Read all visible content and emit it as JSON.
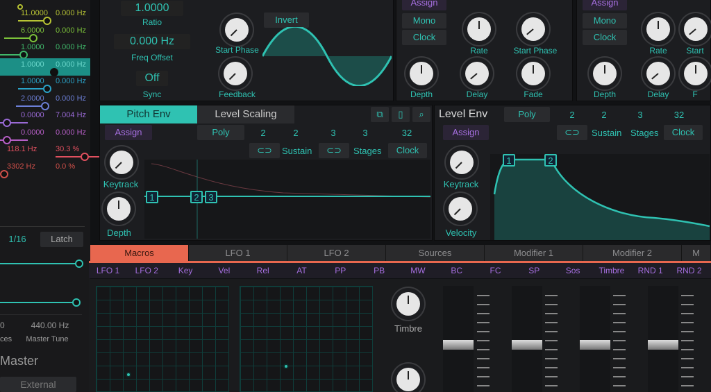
{
  "left_panel": {
    "rows": [
      {
        "value": "11.0000",
        "freq": "0.000 Hz",
        "color": "#b7c334"
      },
      {
        "value": "6.0000",
        "freq": "0.000 Hz",
        "color": "#7cc23a"
      },
      {
        "value": "1.0000",
        "freq": "0.000 Hz",
        "color": "#40b86a"
      },
      {
        "value": "1.0000",
        "freq": "0.000 Hz",
        "color": "#1c8f86",
        "selected": true
      },
      {
        "value": "1.0000",
        "freq": "0.000 Hz",
        "color": "#2aa3c8"
      },
      {
        "value": "2.0000",
        "freq": "0.000 Hz",
        "color": "#6c7fd6"
      },
      {
        "value": "0.0000",
        "freq": "7.004 Hz",
        "color": "#9a6ad6"
      },
      {
        "value": "0.0000",
        "freq": "0.000 Hz",
        "color": "#b85fc8"
      },
      {
        "value": "118.1 Hz",
        "freq": "30.3 %",
        "color": "#e0505f"
      },
      {
        "value": "3302 Hz",
        "freq": "0.0 %",
        "color": "#d0504a"
      }
    ],
    "rate": "1/16",
    "latch": "Latch",
    "voices_value": "0",
    "voices_label": "ces",
    "tune_value": "440.00 Hz",
    "tune_label": "Master Tune",
    "master": "Master",
    "external": "External"
  },
  "operator": {
    "ratio_value": "1.0000",
    "ratio_label": "Ratio",
    "freq_value": "0.000 Hz",
    "freq_label": "Freq Offset",
    "sync_value": "Off",
    "sync_label": "Sync",
    "start_phase": "Start Phase",
    "feedback": "Feedback",
    "invert": "Invert"
  },
  "lfo1": {
    "assign": "Assign",
    "mono": "Mono",
    "clock": "Clock",
    "rate": "Rate",
    "start_phase": "Start Phase",
    "depth": "Depth",
    "delay": "Delay",
    "fade": "Fade"
  },
  "lfo2": {
    "assign": "Assign",
    "mono": "Mono",
    "clock": "Clock",
    "rate": "Rate",
    "start_phase": "Start",
    "depth": "Depth",
    "delay": "Delay",
    "fade": "F"
  },
  "pitch_env": {
    "tab_active": "Pitch Env",
    "tab_other": "Level Scaling",
    "assign": "Assign",
    "poly": "Poly",
    "nums": [
      "2",
      "2",
      "3",
      "3",
      "32"
    ],
    "sustain": "Sustain",
    "stages": "Stages",
    "clock": "Clock",
    "keytrack": "Keytrack",
    "depth": "Depth",
    "nodes": [
      "1",
      "2",
      "3"
    ]
  },
  "level_env": {
    "title": "Level Env",
    "poly": "Poly",
    "nums": [
      "2",
      "2",
      "3",
      "32"
    ],
    "assign": "Assign",
    "sustain": "Sustain",
    "stages": "Stages",
    "clock": "Clock",
    "keytrack": "Keytrack",
    "velocity": "Velocity",
    "nodes": [
      "1",
      "2"
    ]
  },
  "tabs": [
    "Macros",
    "LFO 1",
    "LFO 2",
    "Sources",
    "Modifier 1",
    "Modifier 2",
    "M"
  ],
  "sources": [
    "LFO 1",
    "LFO 2",
    "Key",
    "Vel",
    "Rel",
    "AT",
    "PP",
    "PB",
    "MW",
    "BC",
    "FC",
    "SP",
    "Sos",
    "Timbre",
    "RND 1",
    "RND 2"
  ],
  "macros": {
    "timbre": "Timbre"
  },
  "colors": {
    "accent": "#2fc2b2",
    "macro_tab": "#e8674f",
    "assign": "#a66fe0"
  }
}
